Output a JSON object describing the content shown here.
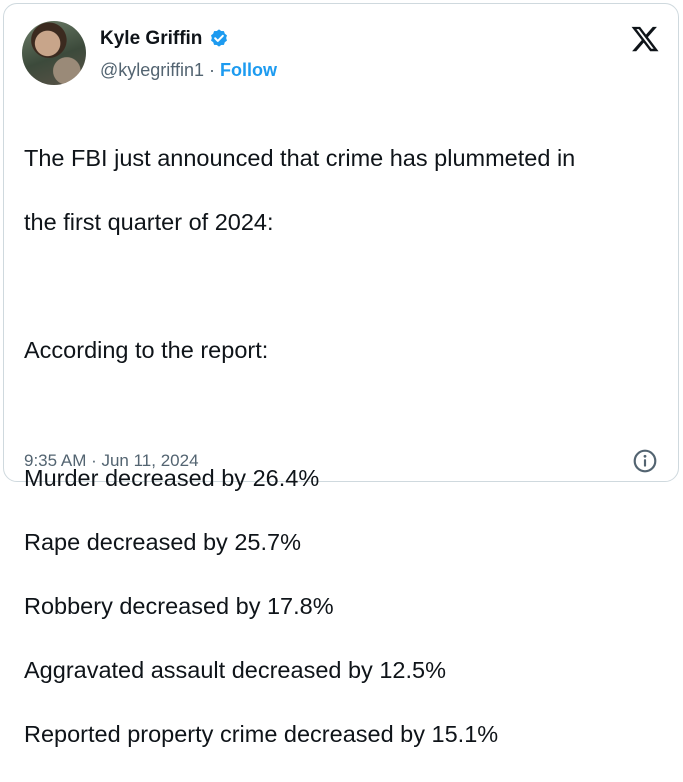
{
  "author": {
    "name": "Kyle Griffin",
    "handle": "@kylegriffin1",
    "separator": "·",
    "follow_label": "Follow"
  },
  "tweet": {
    "lines": [
      "The FBI just announced that crime has plummeted in",
      "the first quarter of 2024:",
      "",
      "According to the report:",
      "",
      "Murder decreased by 26.4%",
      "Rape decreased by 25.7%",
      "Robbery decreased by 17.8%",
      "Aggravated assault decreased by 12.5%",
      "Reported property crime decreased by 15.1%"
    ],
    "timestamp": "9:35 AM · Jun 11, 2024"
  },
  "icons": {
    "verified": "verified-badge-icon",
    "platform": "x-logo-icon",
    "info": "info-icon"
  },
  "colors": {
    "accent": "#1d9bf0",
    "text": "#0f1419",
    "muted": "#536471",
    "border": "#cfd9de"
  }
}
